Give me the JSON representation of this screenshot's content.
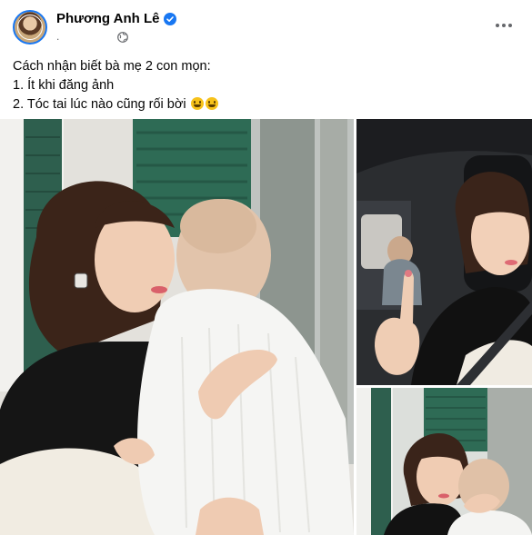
{
  "post": {
    "author": "Phương Anh Lê",
    "meta_separator": ".",
    "caption_lines": [
      "Cách nhận biết bà mẹ 2 con mọn:",
      "1. Ít khi đăng ảnh",
      "2. Tóc tai lúc nào cũng rối bời"
    ]
  },
  "icons": {
    "avatar": "profile-avatar",
    "verified": "verified-badge-icon",
    "audience": "globe-icon",
    "more": "more-horizontal-icon",
    "emojis": [
      "grinning-sweat-emoji",
      "pleading-emoji"
    ]
  },
  "colors": {
    "brand_blue": "#1877f2",
    "text_primary": "#050505",
    "text_secondary": "#65676b",
    "shutter_green": "#2e6b55"
  }
}
